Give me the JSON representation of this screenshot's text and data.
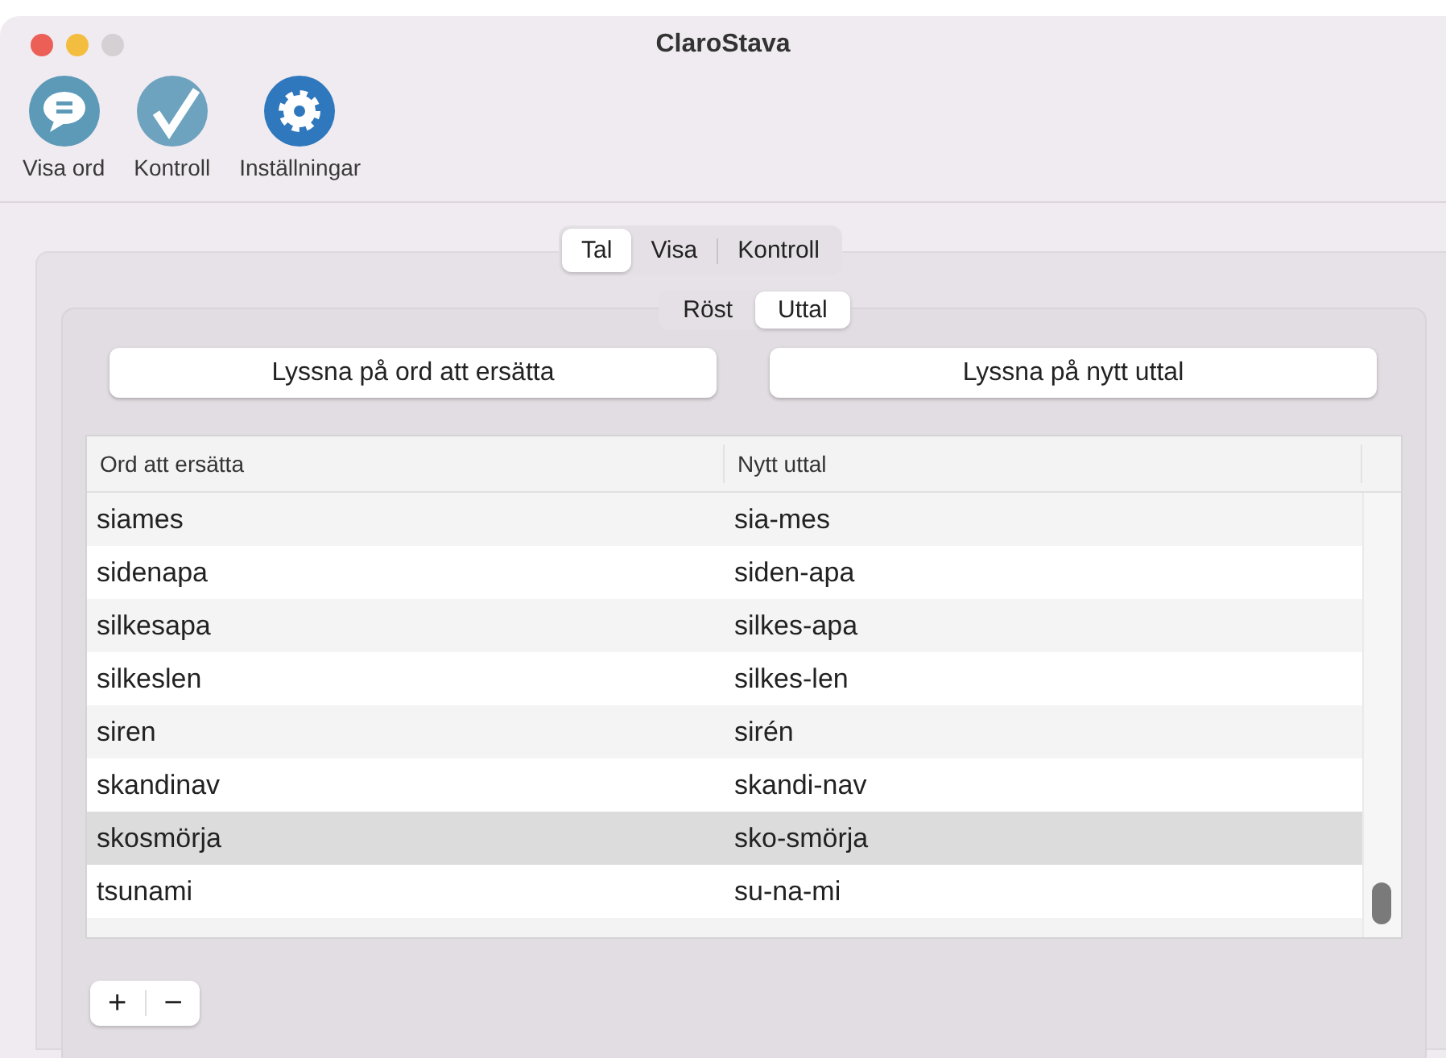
{
  "window": {
    "title": "ClaroStava"
  },
  "toolbar": [
    {
      "label": "Visa ord",
      "kind": "speech"
    },
    {
      "label": "Kontroll",
      "kind": "check"
    },
    {
      "label": "Inställningar",
      "kind": "gear"
    }
  ],
  "tabs": [
    {
      "label": "Tal",
      "selected": true
    },
    {
      "label": "Visa",
      "selected": false
    },
    {
      "label": "Kontroll",
      "selected": false
    }
  ],
  "subtabs": [
    {
      "label": "Röst",
      "selected": false
    },
    {
      "label": "Uttal",
      "selected": true
    }
  ],
  "buttons": [
    "Lyssna på ord att ersätta",
    "Lyssna på nytt uttal"
  ],
  "table": {
    "columns": [
      "Ord att ersätta",
      "Nytt uttal"
    ],
    "rows": [
      {
        "cells": [
          "siames",
          "sia-mes"
        ],
        "selected": false
      },
      {
        "cells": [
          "sidenapa",
          "siden-apa"
        ],
        "selected": false
      },
      {
        "cells": [
          "silkesapa",
          "silkes-apa"
        ],
        "selected": false
      },
      {
        "cells": [
          "silkeslen",
          "silkes-len"
        ],
        "selected": false
      },
      {
        "cells": [
          "siren",
          "sirén"
        ],
        "selected": false
      },
      {
        "cells": [
          "skandinav",
          "skandi-nav"
        ],
        "selected": false
      },
      {
        "cells": [
          "skosmörja",
          "sko-smörja"
        ],
        "selected": true
      },
      {
        "cells": [
          "tsunami",
          "su-na-mi"
        ],
        "selected": false
      }
    ]
  },
  "add_remove": [
    "+",
    "−"
  ]
}
